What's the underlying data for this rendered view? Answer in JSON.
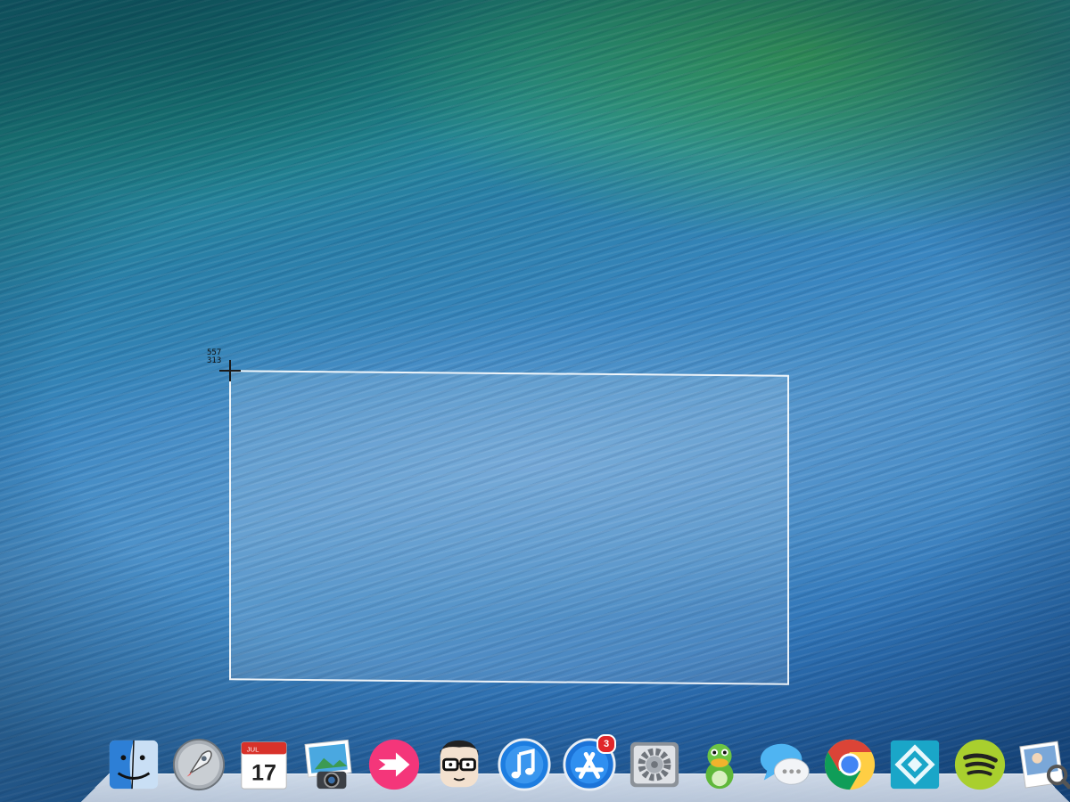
{
  "screen_capture": {
    "cursor_readout": {
      "x": "557",
      "y": "313"
    }
  },
  "dock": {
    "items": [
      {
        "id": "finder",
        "icon": "finder-icon"
      },
      {
        "id": "launchpad",
        "icon": "rocket-icon"
      },
      {
        "id": "calendar",
        "icon": "calendar-icon",
        "month": "JUL",
        "day": "17"
      },
      {
        "id": "iphoto",
        "icon": "photo-camera-icon"
      },
      {
        "id": "skitch",
        "icon": "arrow-icon"
      },
      {
        "id": "character-app",
        "icon": "glasses-face-icon"
      },
      {
        "id": "itunes",
        "icon": "music-note-icon"
      },
      {
        "id": "app-store",
        "icon": "app-store-icon",
        "badge": "3"
      },
      {
        "id": "system-preferences",
        "icon": "gear-icon"
      },
      {
        "id": "adium",
        "icon": "duck-icon"
      },
      {
        "id": "messages",
        "icon": "speech-bubbles-icon"
      },
      {
        "id": "chrome",
        "icon": "chrome-icon"
      },
      {
        "id": "app-teal",
        "icon": "app-diamond-icon"
      },
      {
        "id": "spotify",
        "icon": "spotify-icon"
      },
      {
        "id": "preview",
        "icon": "preview-icon"
      }
    ]
  },
  "colors": {
    "badge": "#e0262a",
    "selection_border": "#ffffff"
  }
}
